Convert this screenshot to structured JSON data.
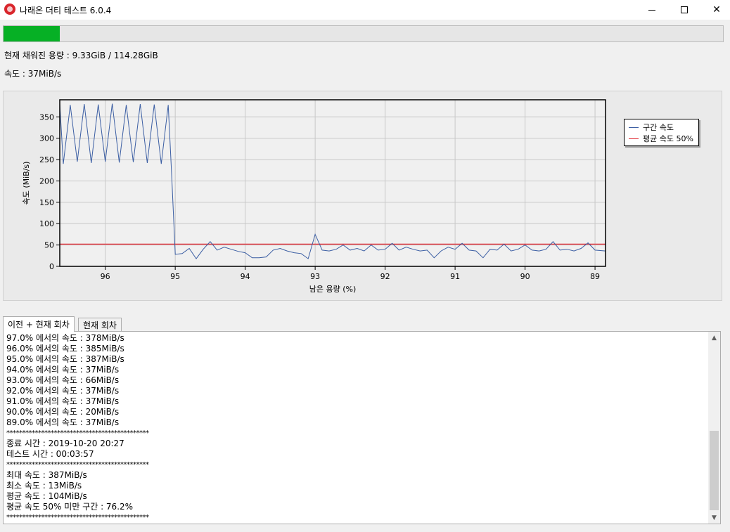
{
  "window": {
    "title": "나래온 더티 테스트 6.0.4",
    "icon": "app-logo-icon"
  },
  "progress": {
    "fraction": 0.0783,
    "color": "#06b025"
  },
  "info": {
    "filled": "현재 채워진 용량 : 9.33GiB / 114.28GiB",
    "speed": "속도 : 37MiB/s"
  },
  "chart_data": {
    "type": "line",
    "xlabel": "남은 용량 (%)",
    "ylabel": "속도 (MiB/s)",
    "xlim": [
      96.65,
      88.85
    ],
    "ylim": [
      0,
      390
    ],
    "x_reversed": true,
    "x_ticks": [
      96,
      95,
      94,
      93,
      92,
      91,
      90,
      89
    ],
    "y_ticks": [
      0,
      50,
      100,
      150,
      200,
      250,
      300,
      350
    ],
    "grid": true,
    "legend_position": "right",
    "series": [
      {
        "name": "구간 속도",
        "color": "#3b5ea3",
        "points": [
          [
            96.65,
            380
          ],
          [
            96.6,
            240
          ],
          [
            96.5,
            378
          ],
          [
            96.4,
            245
          ],
          [
            96.3,
            380
          ],
          [
            96.2,
            242
          ],
          [
            96.1,
            379
          ],
          [
            96.0,
            245
          ],
          [
            95.9,
            381
          ],
          [
            95.8,
            243
          ],
          [
            95.7,
            378
          ],
          [
            95.6,
            244
          ],
          [
            95.5,
            380
          ],
          [
            95.4,
            242
          ],
          [
            95.3,
            379
          ],
          [
            95.2,
            240
          ],
          [
            95.1,
            378
          ],
          [
            95.05,
            210
          ],
          [
            95.0,
            28
          ],
          [
            94.9,
            30
          ],
          [
            94.8,
            42
          ],
          [
            94.7,
            18
          ],
          [
            94.6,
            40
          ],
          [
            94.5,
            58
          ],
          [
            94.4,
            38
          ],
          [
            94.3,
            45
          ],
          [
            94.2,
            40
          ],
          [
            94.1,
            35
          ],
          [
            94.0,
            32
          ],
          [
            93.9,
            20
          ],
          [
            93.8,
            20
          ],
          [
            93.7,
            22
          ],
          [
            93.6,
            38
          ],
          [
            93.5,
            42
          ],
          [
            93.4,
            36
          ],
          [
            93.3,
            32
          ],
          [
            93.2,
            30
          ],
          [
            93.1,
            18
          ],
          [
            93.0,
            75
          ],
          [
            92.9,
            38
          ],
          [
            92.8,
            36
          ],
          [
            92.7,
            40
          ],
          [
            92.6,
            50
          ],
          [
            92.5,
            38
          ],
          [
            92.4,
            42
          ],
          [
            92.3,
            36
          ],
          [
            92.2,
            50
          ],
          [
            92.1,
            38
          ],
          [
            92.0,
            40
          ],
          [
            91.9,
            54
          ],
          [
            91.8,
            38
          ],
          [
            91.7,
            45
          ],
          [
            91.6,
            40
          ],
          [
            91.5,
            36
          ],
          [
            91.4,
            38
          ],
          [
            91.3,
            20
          ],
          [
            91.2,
            36
          ],
          [
            91.1,
            45
          ],
          [
            91.0,
            40
          ],
          [
            90.9,
            54
          ],
          [
            90.8,
            38
          ],
          [
            90.7,
            36
          ],
          [
            90.6,
            20
          ],
          [
            90.5,
            40
          ],
          [
            90.4,
            38
          ],
          [
            90.3,
            52
          ],
          [
            90.2,
            36
          ],
          [
            90.1,
            40
          ],
          [
            90.0,
            50
          ],
          [
            89.9,
            38
          ],
          [
            89.8,
            36
          ],
          [
            89.7,
            40
          ],
          [
            89.6,
            58
          ],
          [
            89.5,
            38
          ],
          [
            89.4,
            40
          ],
          [
            89.3,
            36
          ],
          [
            89.2,
            42
          ],
          [
            89.1,
            55
          ],
          [
            89.0,
            38
          ],
          [
            88.85,
            36
          ]
        ]
      },
      {
        "name": "평균 속도 50%",
        "color": "#e0202a",
        "y": 52
      }
    ]
  },
  "tabs": [
    {
      "label": "이전 + 현재 회차",
      "active": true
    },
    {
      "label": "현재 회차",
      "active": false
    }
  ],
  "log": {
    "speeds": [
      "97.0% 에서의 속도 : 378MiB/s",
      "96.0% 에서의 속도 : 385MiB/s",
      "95.0% 에서의 속도 : 387MiB/s",
      "94.0% 에서의 속도 : 37MiB/s",
      "93.0% 에서의 속도 : 66MiB/s",
      "92.0% 에서의 속도 : 37MiB/s",
      "91.0% 에서의 속도 : 37MiB/s",
      "90.0% 에서의 속도 : 20MiB/s",
      "89.0% 에서의 속도 : 37MiB/s"
    ],
    "stars": "*********************************************",
    "end_time": "종료 시간 : 2019-10-20 20:27",
    "test_time": "테스트 시간 : 00:03:57",
    "stats": [
      "최대 속도 : 387MiB/s",
      "최소 속도 : 13MiB/s",
      "평균 속도 : 104MiB/s",
      "평균 속도 50% 미만 구간 : 76.2%"
    ]
  }
}
